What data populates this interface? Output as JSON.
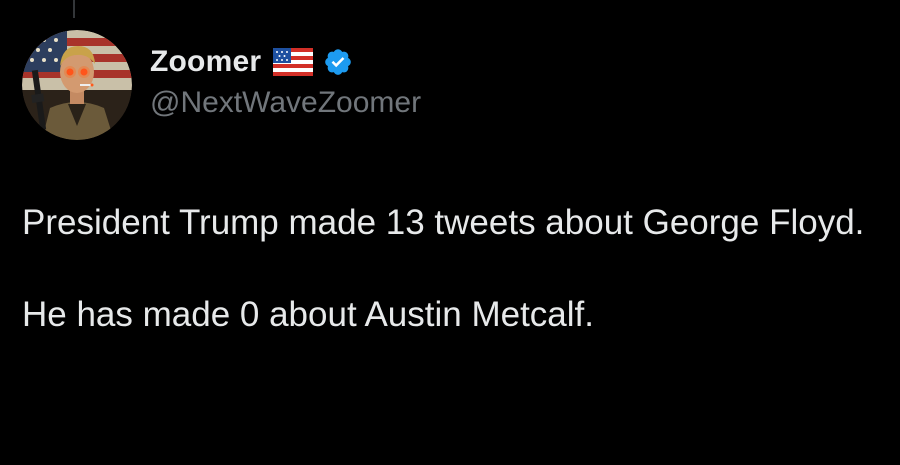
{
  "author": {
    "display_name": "Zoomer",
    "handle": "@NextWaveZoomer",
    "flag": "us-flag-icon",
    "verified": true,
    "verified_color": "#1d9bf0",
    "avatar": "avatar-image"
  },
  "tweet": {
    "paragraphs": [
      "President Trump made 13 tweets about George Floyd.",
      "He has made 0 about Austin Metcalf."
    ]
  },
  "colors": {
    "background": "#000000",
    "text": "#e7e9ea",
    "secondary_text": "#71767b",
    "accent": "#1d9bf0"
  }
}
